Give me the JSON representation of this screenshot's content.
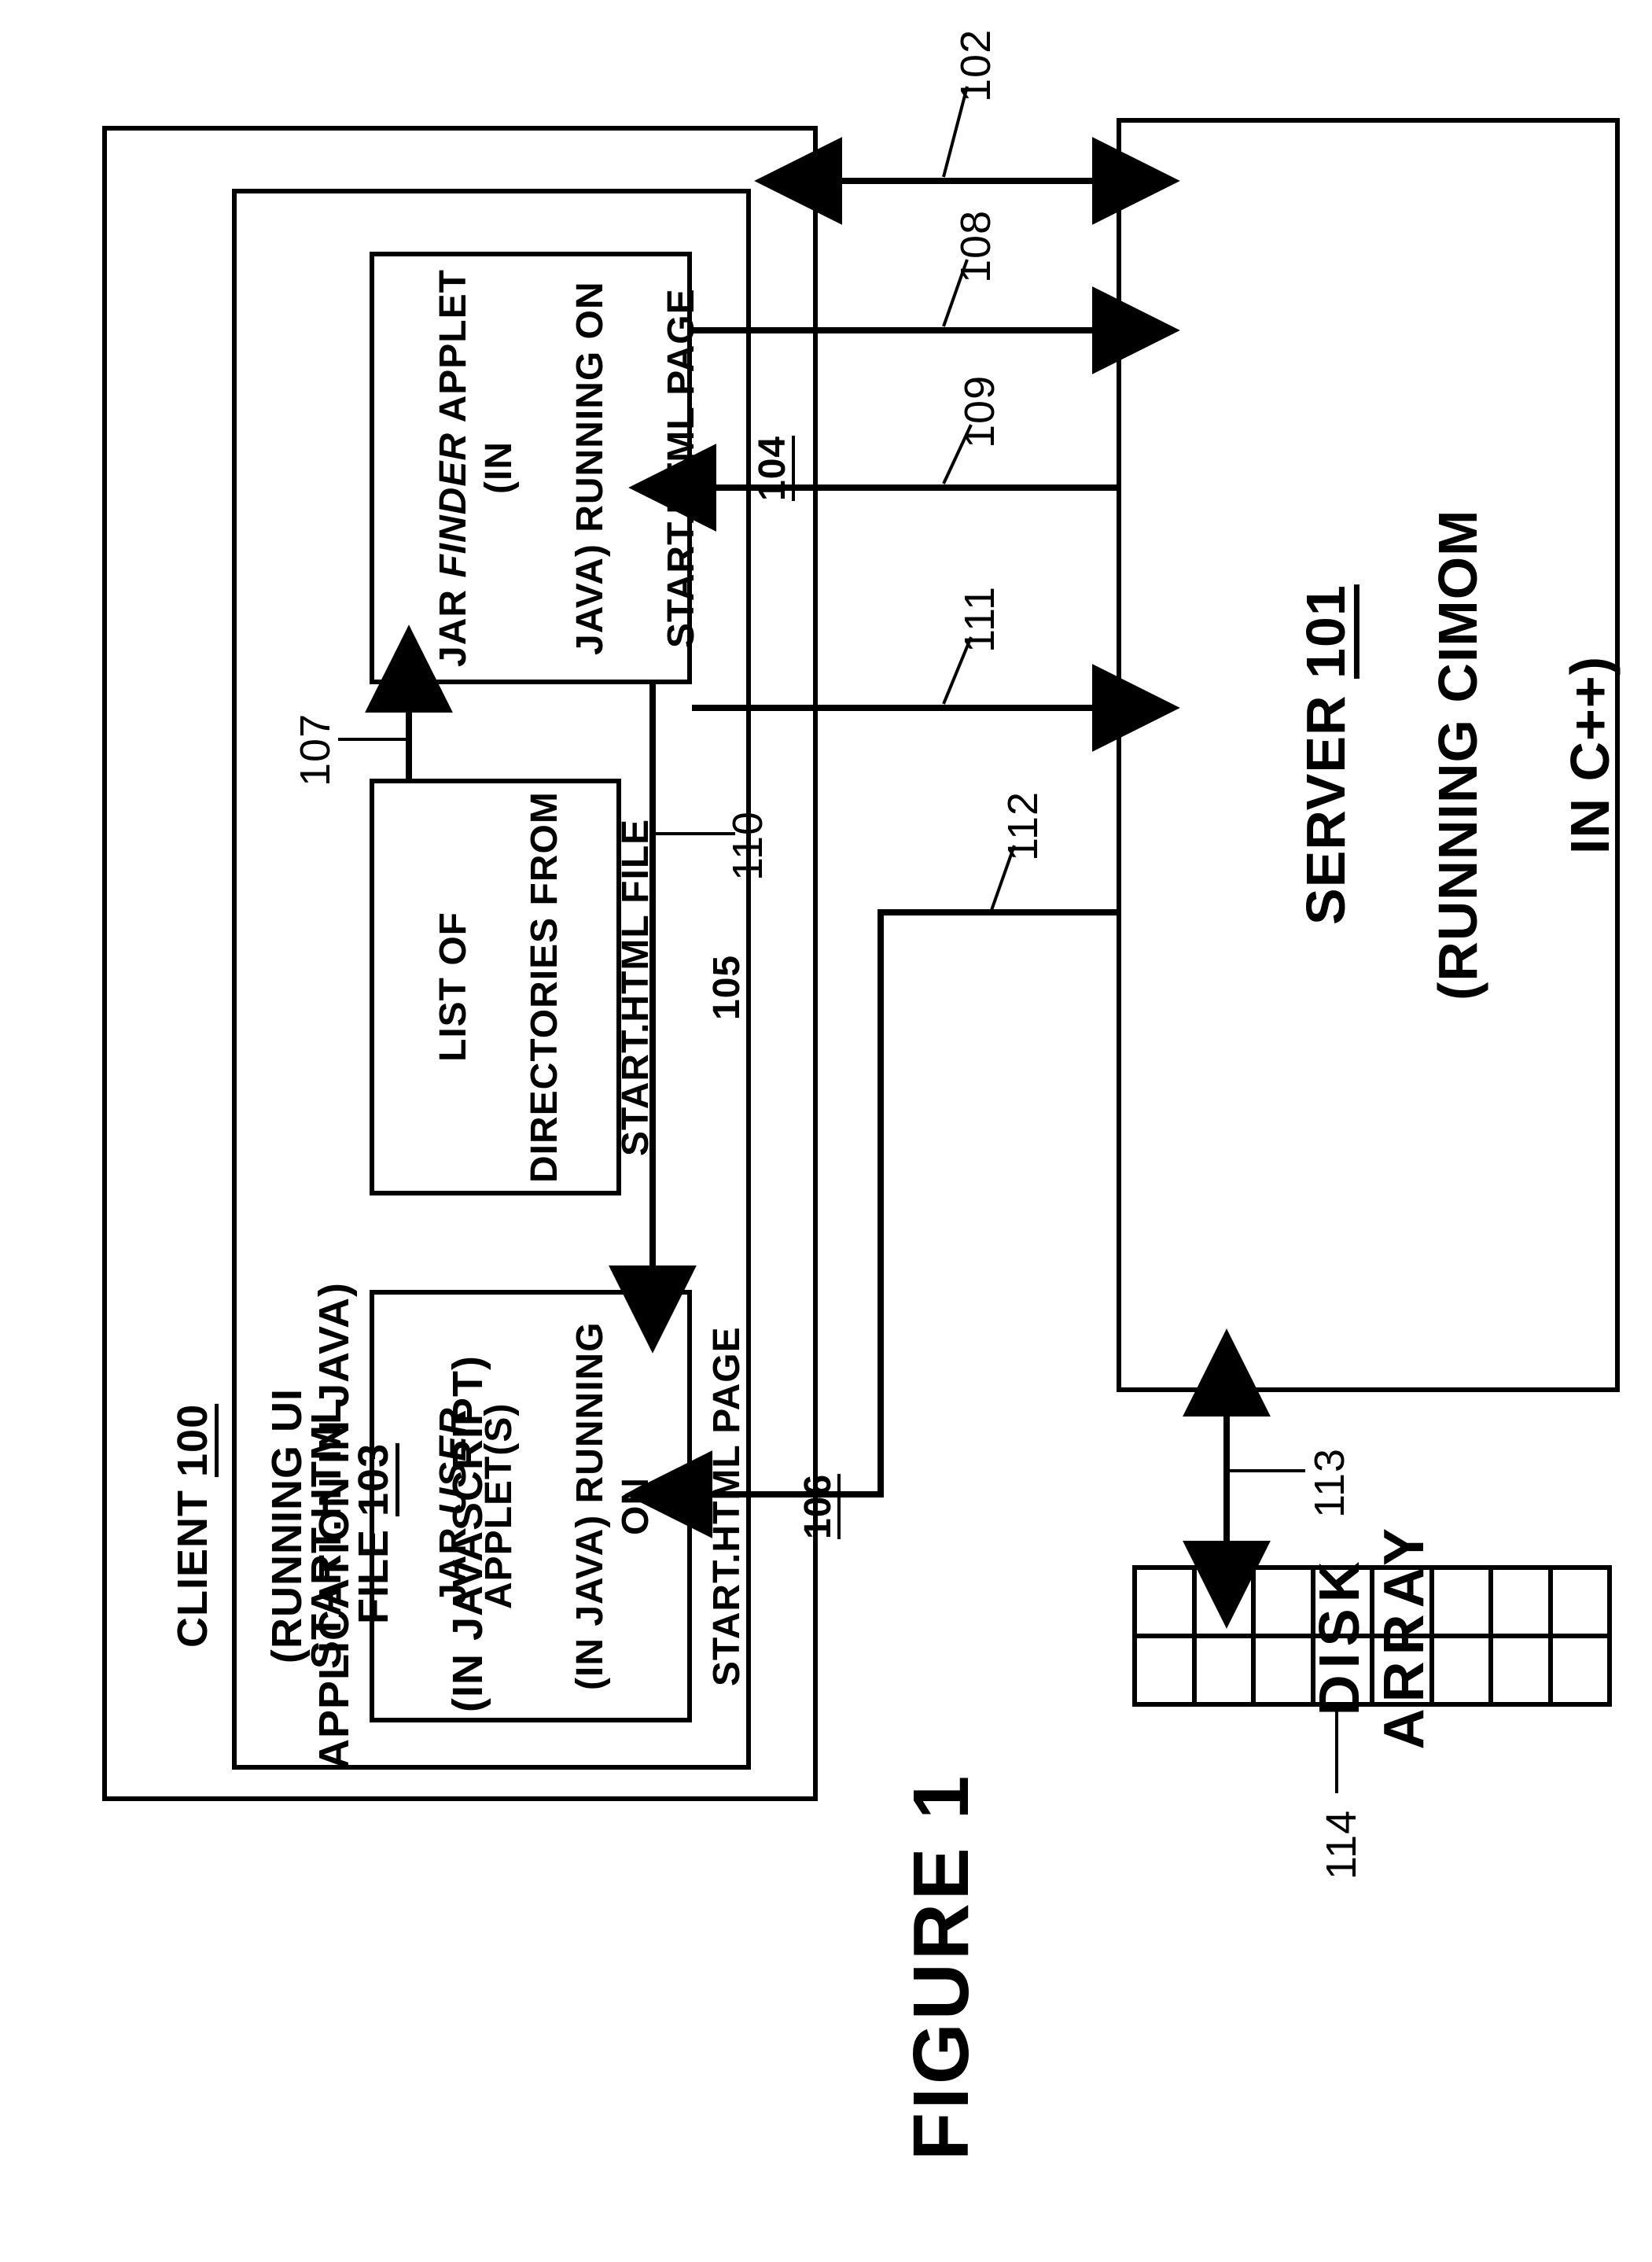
{
  "figure_title": "FIGURE 1",
  "client": {
    "title": "CLIENT",
    "ref": "100",
    "subtitle": "(RUNNING UI APPLICATION IN JAVA)"
  },
  "start_html": {
    "title": "START.HTML FILE",
    "ref": "103",
    "subtitle": "(IN JAVASCRIPT)"
  },
  "boxes": {
    "finder": {
      "l1_pre": "JAR ",
      "l1_em": "FINDER",
      "l1_post": " APPLET (IN",
      "l2": "JAVA) RUNNING ON",
      "l3": "START.HTML PAGE",
      "ref": "104"
    },
    "dirs": {
      "l1": "LIST OF",
      "l2": "DIRECTORIES FROM",
      "l3": "START.HTML FILE",
      "ref": "105"
    },
    "user": {
      "l1_pre": "JAR ",
      "l1_em": "USER",
      "l1_post": " APPLET(S)",
      "l2": "(IN JAVA) RUNNING ON",
      "l3": "START.HTML PAGE",
      "ref": "106"
    }
  },
  "server": {
    "title": "SERVER",
    "ref": "101",
    "l2": "(RUNNING CIMOM",
    "l3": "IN C++)"
  },
  "disk": {
    "label": "DISK ARRAY"
  },
  "refs": {
    "r102": "102",
    "r107": "107",
    "r108": "108",
    "r109": "109",
    "r110": "110",
    "r111": "111",
    "r112": "112",
    "r113": "113",
    "r114": "114"
  }
}
